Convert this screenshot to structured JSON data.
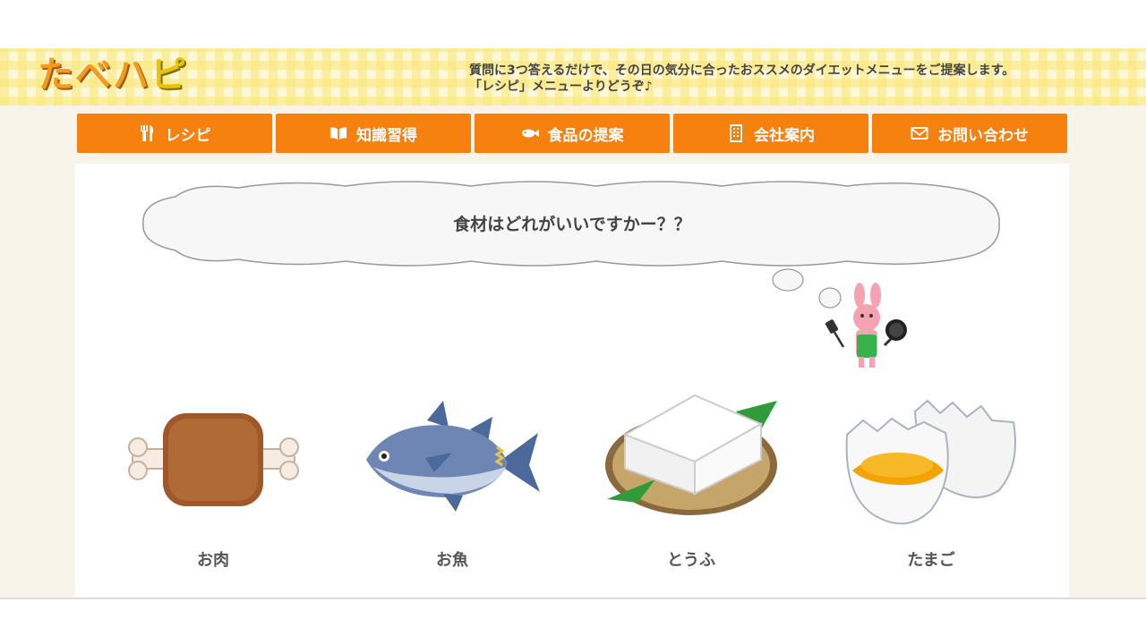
{
  "site": {
    "logo_main": "たべハ",
    "logo_accent": "ピ",
    "tagline_line1": "質問に3つ答えるだけで、その日の気分に合ったおススメのダイエットメニューをご提案します。",
    "tagline_line2": "「レシピ」メニューよりどうぞ♪"
  },
  "nav": [
    {
      "label": "レシピ",
      "icon": "fork-knife-icon"
    },
    {
      "label": "知識習得",
      "icon": "book-icon"
    },
    {
      "label": "食品の提案",
      "icon": "fish-icon"
    },
    {
      "label": "会社案内",
      "icon": "building-icon"
    },
    {
      "label": "お問い合わせ",
      "icon": "mail-icon"
    }
  ],
  "question": {
    "text": "食材はどれがいいですかー？？"
  },
  "choices": [
    {
      "label": "お肉",
      "icon": "meat-icon"
    },
    {
      "label": "お魚",
      "icon": "fish-illustration-icon"
    },
    {
      "label": "とうふ",
      "icon": "tofu-icon"
    },
    {
      "label": "たまご",
      "icon": "egg-icon"
    }
  ],
  "colors": {
    "nav_bg": "#f7810f",
    "header_bg": "#fdf9d8",
    "page_bg": "#f8f4ea"
  }
}
